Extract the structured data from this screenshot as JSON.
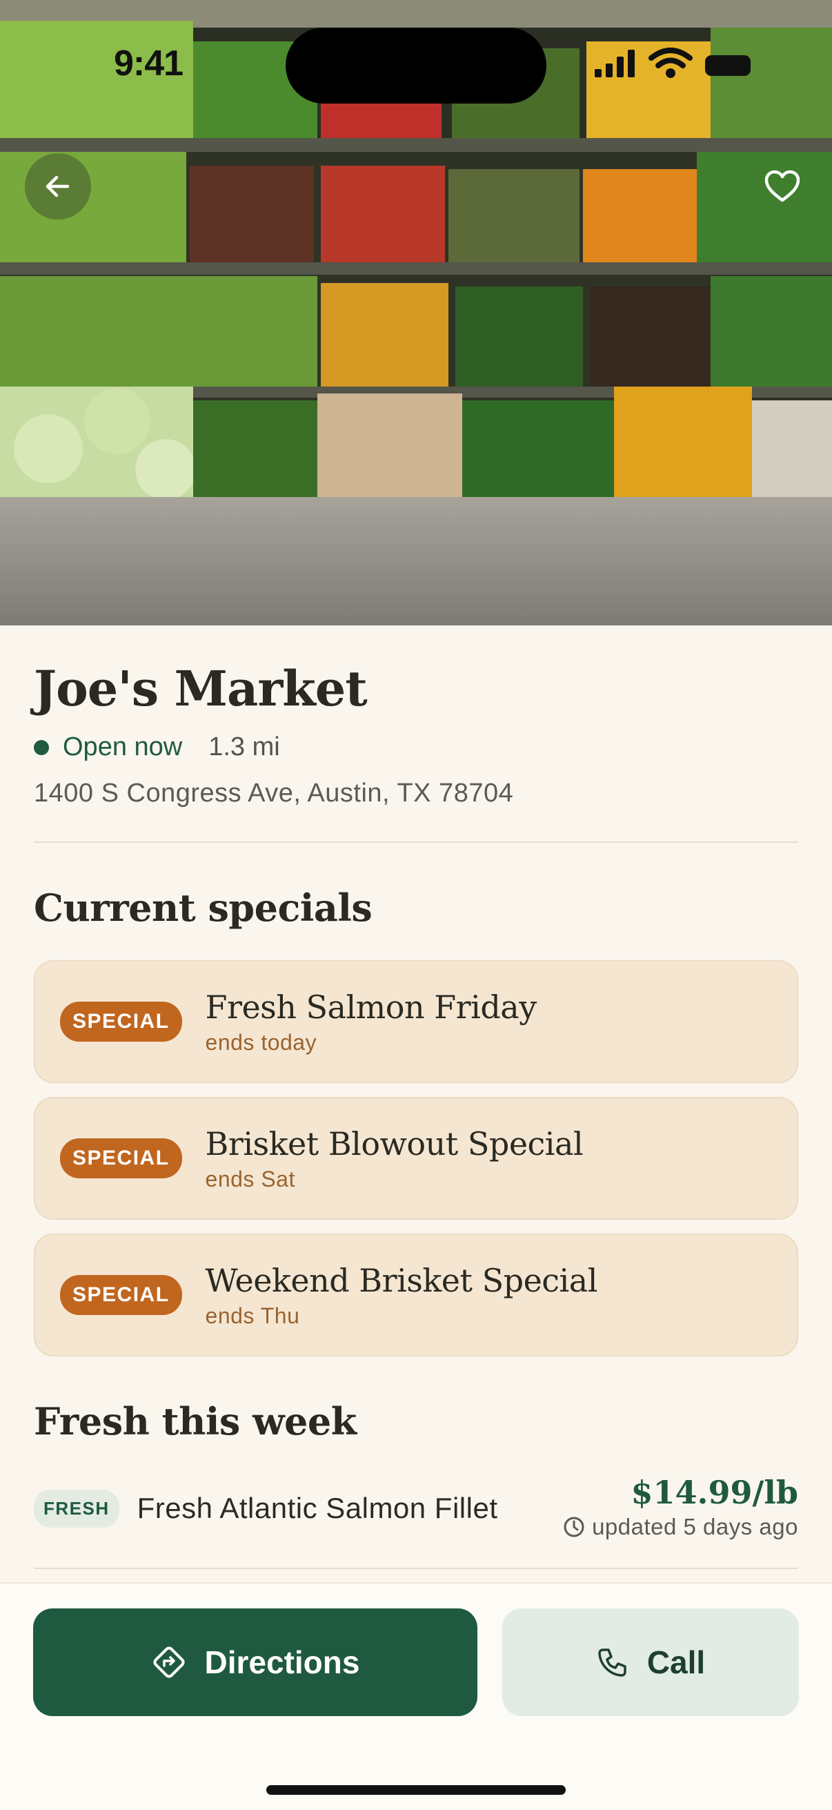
{
  "status_bar": {
    "time": "9:41"
  },
  "store": {
    "name": "Joe's Market",
    "status": "Open now",
    "distance": "1.3 mi",
    "address": "1400 S Congress Ave, Austin, TX 78704"
  },
  "specials": {
    "title": "Current specials",
    "items": [
      {
        "badge": "SPECIAL",
        "name": "Fresh Salmon Friday",
        "ends": "ends today"
      },
      {
        "badge": "SPECIAL",
        "name": "Brisket Blowout Special",
        "ends": "ends Sat"
      },
      {
        "badge": "SPECIAL",
        "name": "Weekend Brisket Special",
        "ends": "ends Thu"
      }
    ]
  },
  "fresh": {
    "title": "Fresh this week",
    "items": [
      {
        "badge": "FRESH",
        "name": "Fresh Atlantic Salmon Fillet",
        "price": "$14.99/lb",
        "updated": "updated 5 days ago"
      }
    ]
  },
  "actions": {
    "directions": "Directions",
    "call": "Call"
  },
  "icons": {
    "back": "arrow-left-icon",
    "favorite": "heart-icon",
    "directions": "directions-diamond-icon",
    "call": "phone-icon",
    "updated": "clock-icon"
  },
  "colors": {
    "primary": "#1f5a40",
    "special": "#c1661f",
    "background": "#faf6ee"
  }
}
